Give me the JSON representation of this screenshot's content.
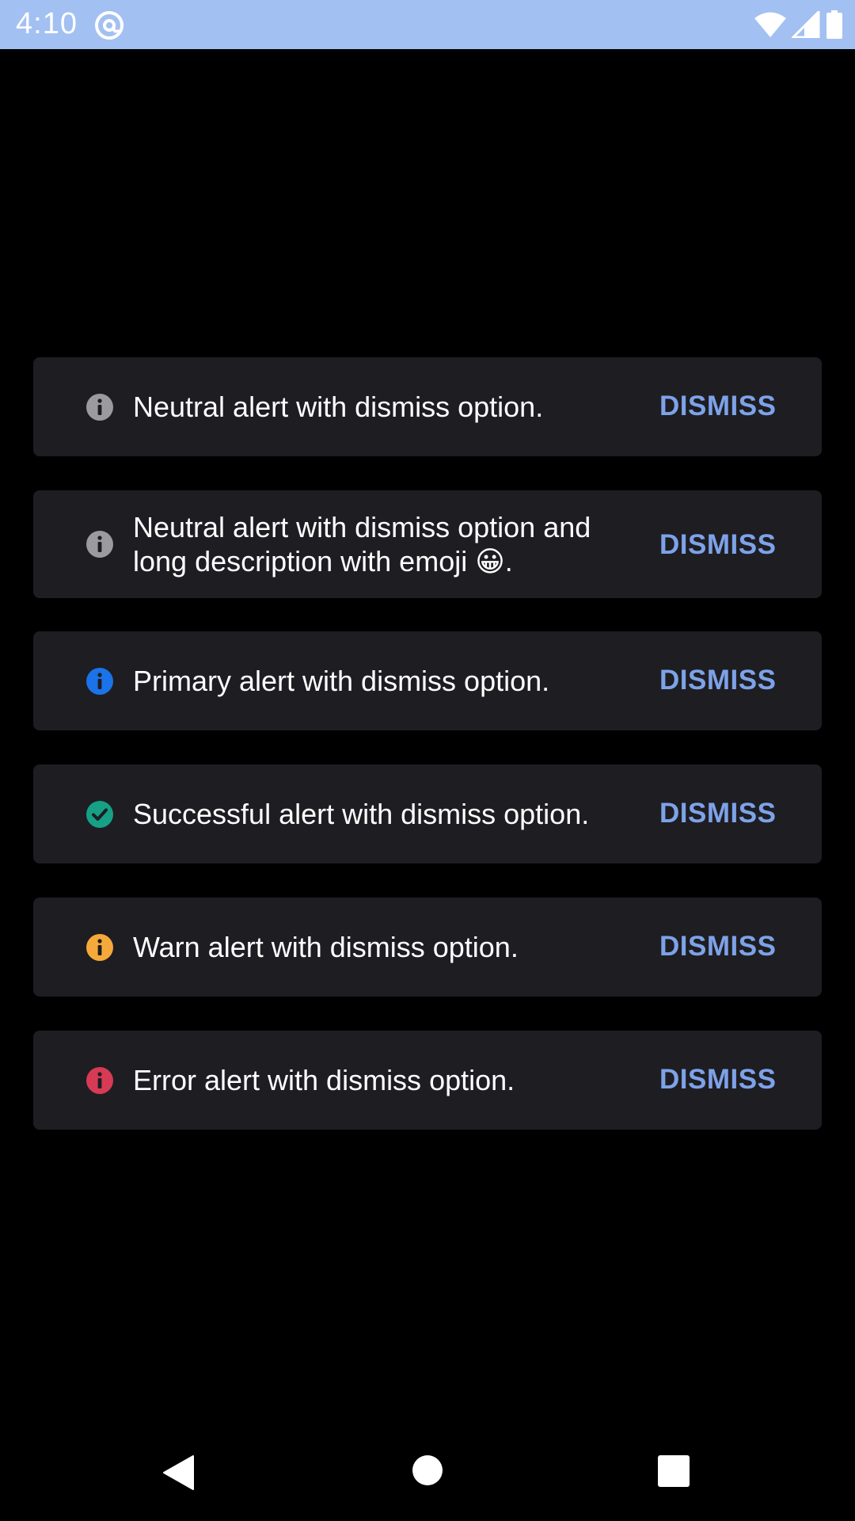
{
  "status_bar": {
    "time": "4:10",
    "app_icon": "at-sign-circle-icon",
    "icons": [
      "wifi-icon",
      "signal-icon",
      "battery-icon"
    ],
    "background": "#a3c0f2"
  },
  "alerts": [
    {
      "variant": "neutral",
      "icon": "info-icon",
      "icon_color": "#9b9b9f",
      "text": "Neutral alert with dismiss option.",
      "action": "DISMISS"
    },
    {
      "variant": "neutral",
      "icon": "info-icon",
      "icon_color": "#9b9b9f",
      "text": "Neutral alert with dismiss option and long description with emoji 😀.",
      "action": "DISMISS"
    },
    {
      "variant": "primary",
      "icon": "info-icon",
      "icon_color": "#1a73e8",
      "text": "Primary alert with dismiss option.",
      "action": "DISMISS"
    },
    {
      "variant": "success",
      "icon": "check-circle-icon",
      "icon_color": "#16a085",
      "text": "Successful alert with dismiss option.",
      "action": "DISMISS"
    },
    {
      "variant": "warn",
      "icon": "info-icon",
      "icon_color": "#f5a93a",
      "text": "Warn alert with dismiss option.",
      "action": "DISMISS"
    },
    {
      "variant": "error",
      "icon": "info-icon",
      "icon_color": "#d63a55",
      "text": "Error alert with dismiss option.",
      "action": "DISMISS"
    }
  ],
  "colors": {
    "background": "#000000",
    "alert_background": "#1e1d22",
    "alert_text": "#ffffff",
    "action": "#7da2e8"
  },
  "nav_bar": {
    "icons": [
      "back-icon",
      "home-icon",
      "recents-icon"
    ]
  }
}
